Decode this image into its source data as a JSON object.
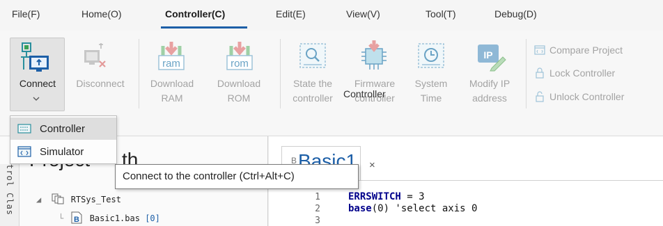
{
  "menubar": {
    "items": [
      "File(F)",
      "Home(O)",
      "Controller(C)",
      "Edit(E)",
      "View(V)",
      "Tool(T)",
      "Debug(D)"
    ],
    "active_index": 2
  },
  "ribbon": {
    "connect": {
      "label": "Connect"
    },
    "disconnect": {
      "label": "Disconnect"
    },
    "download_ram": {
      "line1": "Download",
      "line2": "RAM",
      "icon_text": "ram"
    },
    "download_rom": {
      "line1": "Download",
      "line2": "ROM",
      "icon_text": "rom"
    },
    "state": {
      "line1": "State the",
      "line2": "controller"
    },
    "firmware": {
      "line1": "Firmware",
      "line2": "controller"
    },
    "system_time": {
      "line1": "System",
      "line2": "Time"
    },
    "modify_ip": {
      "line1": "Modify IP",
      "line2": "address",
      "icon_text": "IP"
    },
    "compare_project": "Compare Project",
    "lock_controller": "Lock Controller",
    "unlock_controller": "Unlock Controller",
    "group_label": "Controller"
  },
  "dropdown": {
    "items": [
      {
        "label": "Controller",
        "highlighted": true
      },
      {
        "label": "Simulator",
        "highlighted": false
      }
    ]
  },
  "tooltip": {
    "text": "Connect to the controller (Ctrl+Alt+C)"
  },
  "project": {
    "title": "Project",
    "title_partial": "th",
    "vertical_label": "trol Clas",
    "root": "RTSys_Test",
    "file": "Basic1.bas",
    "file_index": "[0]"
  },
  "editor": {
    "tab_title": "Basic1",
    "tab_prefix": "B",
    "close": "×",
    "lines": [
      {
        "num": "1",
        "kw": "ERRSWITCH",
        "rest": " = 3"
      },
      {
        "num": "2",
        "kw": "base",
        "rest": "(0) 'select axis 0"
      },
      {
        "num": "3",
        "kw": "",
        "rest": ""
      }
    ]
  },
  "colors": {
    "accent": "#1d5fa7",
    "disabled_text": "#a3a3a3",
    "icon_teal": "#2a8f9d",
    "icon_green": "#3aa055",
    "icon_red": "#d9534f"
  }
}
